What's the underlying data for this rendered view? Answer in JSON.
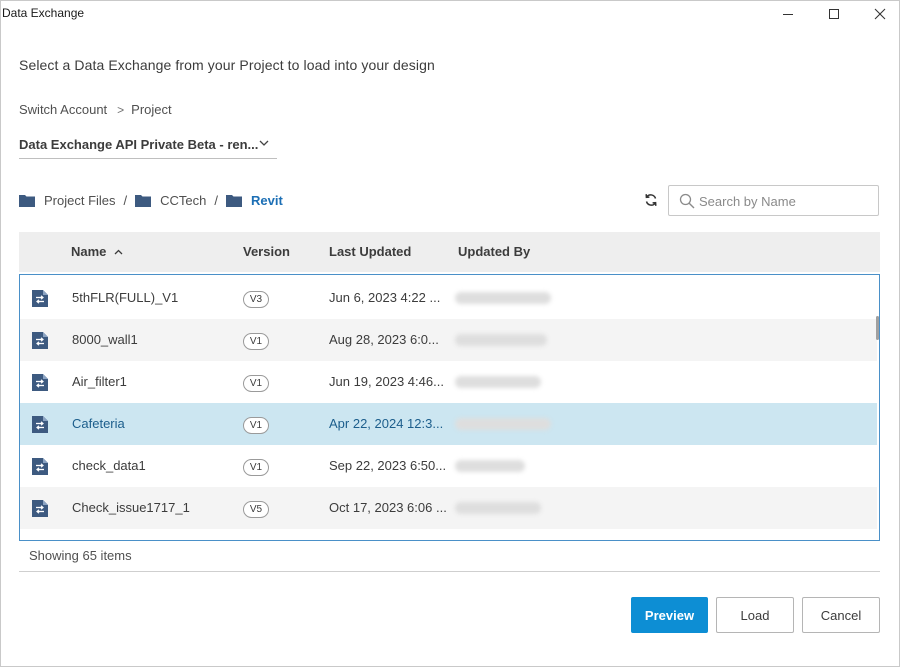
{
  "window": {
    "title": "Data Exchange",
    "minimize_icon": "minimize-icon",
    "maximize_icon": "maximize-icon",
    "close_icon": "close-icon"
  },
  "instruction": "Select a Data Exchange from your Project to load into your design",
  "nav": {
    "switch_account": "Switch Account",
    "separator": ">",
    "project": "Project"
  },
  "project_select": {
    "value": "Data Exchange API Private Beta - ren...",
    "icon": "chevron-down-icon"
  },
  "breadcrumb": [
    {
      "label": "Project Files",
      "icon": "folder-icon"
    },
    {
      "label": "CCTech",
      "icon": "folder-icon"
    },
    {
      "label": "Revit",
      "icon": "folder-icon",
      "active": true
    }
  ],
  "breadcrumb_separator": "/",
  "search": {
    "placeholder": "Search by Name",
    "icon": "search-icon",
    "refresh_icon": "refresh-icon"
  },
  "table": {
    "columns": {
      "name": "Name",
      "version": "Version",
      "last_updated": "Last Updated",
      "updated_by": "Updated By"
    },
    "sort_icon": "sort-ascending-icon",
    "rows": [
      {
        "name": "5thFLR(FULL)_V1",
        "version": "V3",
        "last_updated": "Jun 6, 2023 4:22 ...",
        "updated_by_redacted": true
      },
      {
        "name": "8000_wall1",
        "version": "V1",
        "last_updated": "Aug 28, 2023 6:0...",
        "updated_by_redacted": true
      },
      {
        "name": "Air_filter1",
        "version": "V1",
        "last_updated": "Jun 19, 2023 4:46...",
        "updated_by_redacted": true
      },
      {
        "name": "Cafeteria",
        "version": "V1",
        "last_updated": "Apr 22, 2024 12:3...",
        "updated_by_redacted": true,
        "selected": true
      },
      {
        "name": "check_data1",
        "version": "V1",
        "last_updated": "Sep 22, 2023 6:50...",
        "updated_by_redacted": true
      },
      {
        "name": "Check_issue1717_1",
        "version": "V5",
        "last_updated": "Oct 17, 2023 6:06 ...",
        "updated_by_redacted": true
      }
    ]
  },
  "status": "Showing 65 items",
  "buttons": {
    "preview": "Preview",
    "load": "Load",
    "cancel": "Cancel"
  },
  "colors": {
    "accent": "#0d8ed4",
    "selected_row": "#cce6f1",
    "link": "#1c6fb5",
    "file_icon": "#3d5a80",
    "folder": "#3d5a80"
  }
}
